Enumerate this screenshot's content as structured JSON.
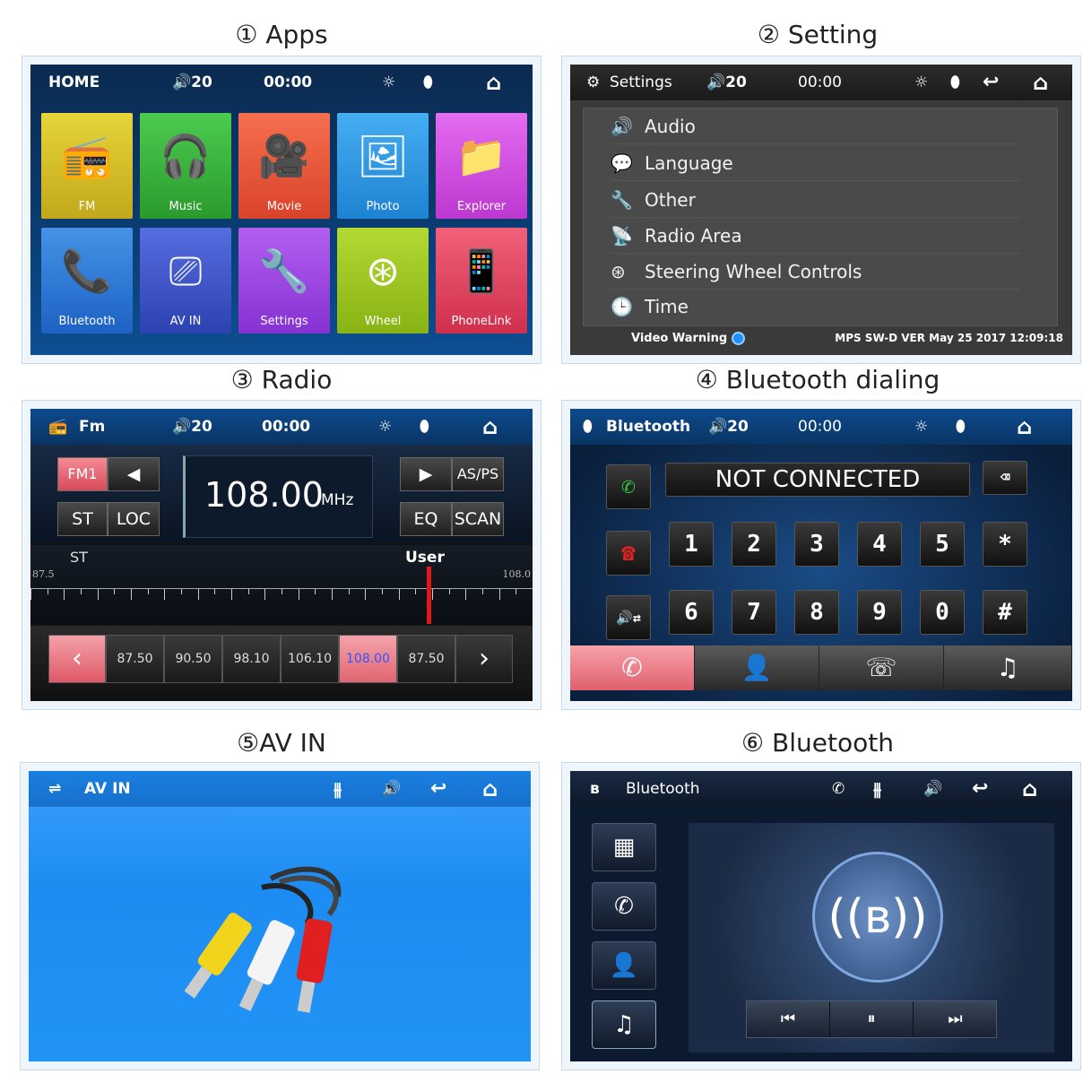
{
  "captions": {
    "apps": "① Apps",
    "setting": "② Setting",
    "radio": "③ Radio",
    "bt_dialing": "④ Bluetooth dialing",
    "av_in": "⑤AV IN",
    "bluetooth": "⑥ Bluetooth"
  },
  "apps": {
    "title": "HOME",
    "volume": "20",
    "time": "00:00",
    "tiles": [
      {
        "label": "FM",
        "color": "#d7c125"
      },
      {
        "label": "Music",
        "color": "#35b539"
      },
      {
        "label": "Movie",
        "color": "#ef5a3c"
      },
      {
        "label": "Photo",
        "color": "#2b97e8"
      },
      {
        "label": "Explorer",
        "color": "#d34ee0"
      },
      {
        "label": "Bluetooth",
        "color": "#2c78d8"
      },
      {
        "label": "AV IN",
        "color": "#3a55c8"
      },
      {
        "label": "Settings",
        "color": "#9b3fe0"
      },
      {
        "label": "Wheel",
        "color": "#9cc71b"
      },
      {
        "label": "PhoneLink",
        "color": "#e5415e"
      }
    ]
  },
  "settings": {
    "title": "Settings",
    "volume": "20",
    "time": "00:00",
    "items": [
      "Audio",
      "Language",
      "Other",
      "Radio Area",
      "Steering Wheel Controls",
      "Time"
    ],
    "video_warning": "Video Warning",
    "version": "MPS SW-D VER May 25 2017 12:09:18"
  },
  "radio": {
    "title": "Fm",
    "volume": "20",
    "time": "00:00",
    "band": "FM1",
    "st": "ST",
    "loc": "LOC",
    "frequency": "108.00",
    "unit": "MHz",
    "asps": "AS/PS",
    "eq": "EQ",
    "scan": "SCAN",
    "st_label": "ST",
    "user_label": "User",
    "scale_min": "87.5",
    "scale_max": "108.0",
    "tuner_fraction": 0.79,
    "presets": [
      "87.50",
      "90.50",
      "98.10",
      "106.10",
      "108.00",
      "87.50"
    ],
    "active_preset": 4
  },
  "bt_dial": {
    "title": "Bluetooth",
    "volume": "20",
    "time": "00:00",
    "status": "NOT CONNECTED",
    "keys_row1": [
      "1",
      "2",
      "3",
      "4",
      "5",
      "*"
    ],
    "keys_row2": [
      "6",
      "7",
      "8",
      "9",
      "0",
      "#"
    ]
  },
  "av_in": {
    "title": "AV IN"
  },
  "bluetooth": {
    "title": "Bluetooth"
  }
}
